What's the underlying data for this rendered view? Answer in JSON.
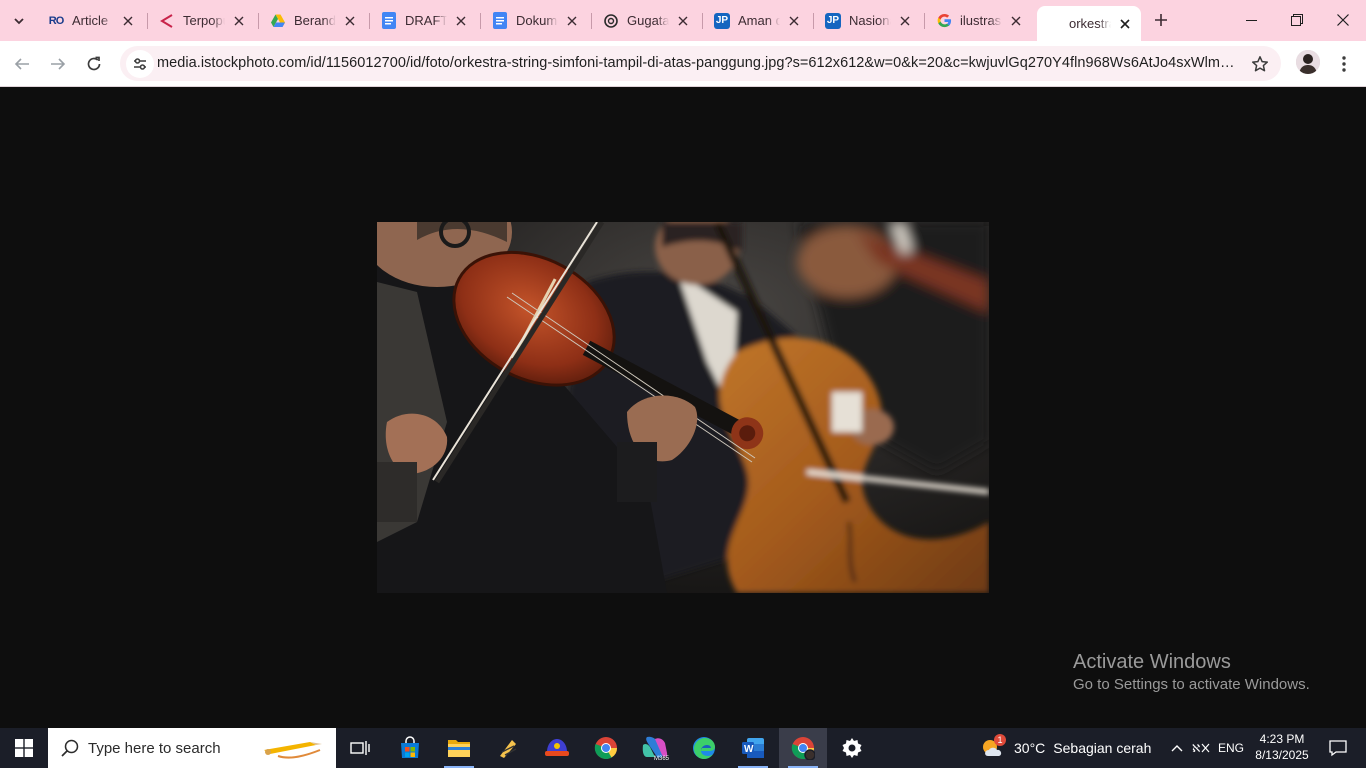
{
  "browser": {
    "tabs": [
      {
        "title": "Article",
        "favicon": "ro-icon"
      },
      {
        "title": "Terpopuler",
        "favicon": "ketik-icon"
      },
      {
        "title": "Beranda",
        "favicon": "drive-icon"
      },
      {
        "title": "DRAFT",
        "favicon": "docs-icon"
      },
      {
        "title": "Dokumen",
        "favicon": "docs-icon"
      },
      {
        "title": "Gugatan",
        "favicon": "openai-icon"
      },
      {
        "title": "Aman di",
        "favicon": "jp-icon"
      },
      {
        "title": "Nasional",
        "favicon": "jp-icon"
      },
      {
        "title": "ilustrasi",
        "favicon": "google-icon"
      },
      {
        "title": "orkestra",
        "favicon": "none",
        "active": true
      }
    ],
    "url": "media.istockphoto.com/id/1156012700/id/foto/orkestra-string-simfoni-tampil-di-atas-panggung.jpg?s=612x612&w=0&k=20&c=kwjuvlGq270Y4fln968Ws6AtJo4sxWlmy_m...",
    "accent_color": "#fcd3e0"
  },
  "page": {
    "image_subject": "violinists and cellist performing in a string orchestra"
  },
  "watermark": {
    "line1": "Activate Windows",
    "line2": "Go to Settings to activate Windows."
  },
  "taskbar": {
    "search_placeholder": "Type here to search",
    "weather": {
      "temp": "30°C",
      "desc": "Sebagian cerah",
      "badge": "1"
    },
    "language": "ENG",
    "time": "4:23 PM",
    "date": "8/13/2025",
    "apps": [
      "task-view",
      "microsoft-store",
      "file-explorer",
      "app-pen",
      "app-hat",
      "chrome",
      "microsoft-365",
      "edge",
      "word",
      "chrome-profile",
      "settings"
    ]
  }
}
